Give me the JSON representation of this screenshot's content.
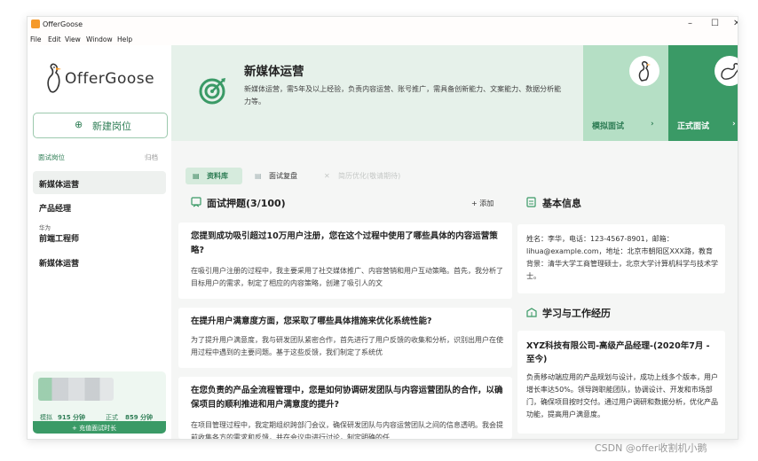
{
  "window": {
    "title": "OfferGoose",
    "controls": {
      "minimize": "–",
      "maximize": "☐",
      "close": "✕"
    }
  },
  "menu": [
    "File",
    "Edit",
    "View",
    "Window",
    "Help"
  ],
  "sidebar": {
    "logo_text": "OfferGoose",
    "new_position_label": "新建岗位",
    "section_label": "面试岗位",
    "archive_label": "归档",
    "items": [
      {
        "title": "新媒体运营",
        "sub": ""
      },
      {
        "title": "产品经理",
        "sub": ""
      },
      {
        "title": "前端工程师",
        "sub": "华为"
      },
      {
        "title": "新媒体运营",
        "sub": ""
      }
    ],
    "stats": {
      "mock_label": "模拟",
      "mock_value": "915 分钟",
      "real_label": "正式",
      "real_value": "859 分钟",
      "recharge_label": "+ 充值面试时长"
    }
  },
  "header": {
    "title": "新媒体运营",
    "description": "新媒体运营，需5年及以上经验，负责内容运营、账号推广，需具备创新能力、文案能力、数据分析能力等。",
    "mock_interview": "模拟面试",
    "real_interview": "正式面试",
    "chevron": "›"
  },
  "tabs": [
    {
      "label": "资料库",
      "state": "active"
    },
    {
      "label": "面试复盘",
      "state": "normal"
    },
    {
      "label": "简历优化(敬请期待)",
      "state": "disabled"
    }
  ],
  "questions": {
    "title": "面试押题(3/100)",
    "add_label": "+ 添加",
    "items": [
      {
        "question": "您提到成功吸引超过10万用户注册，您在这个过程中使用了哪些具体的内容运营策略?",
        "answer": "在吸引用户注册的过程中，我主要采用了社交媒体推广、内容营销和用户互动策略。首先，我分析了目标用户的需求，制定了相应的内容策略，创建了吸引人的文"
      },
      {
        "question": "在提升用户满意度方面，您采取了哪些具体措施来优化系统性能?",
        "answer": "为了提升用户满意度，我与研发团队紧密合作，首先进行了用户反馈的收集和分析，识别出用户在使用过程中遇到的主要问题。基于这些反馈，我们制定了系统优"
      },
      {
        "question": "在您负责的产品全流程管理中，您是如何协调研发团队与内容运营团队的合作，以确保项目的顺利推进和用户满意度的提升?",
        "answer": "在项目管理过程中，我定期组织跨部门会议，确保研发团队与内容运营团队之间的信息透明。我会提前收集各方的需求和反馈，并在会议中进行讨论，制定明确的任"
      }
    ]
  },
  "basic_info": {
    "title": "基本信息",
    "text": "姓名：李华，电话：123-4567-8901，邮箱：lihua@example.com，地址：北京市朝阳区XXX路，教育背景：清华大学工商管理硕士，北京大学计算机科学与技术学士。"
  },
  "experience": {
    "title": "学习与工作经历",
    "entry_title": "XYZ科技有限公司-高级产品经理-(2020年7月 - 至今)",
    "entry_body": "负责移动端应用的产品规划与设计，成功上线多个版本，用户增长率达50%。领导跨职能团队，协调设计、开发和市场部门，确保项目按时交付。通过用户调研和数据分析，优化产品功能，提高用户满意度。"
  },
  "watermark": "CSDN @offer收割机小鹅",
  "colors": {
    "brand_green": "#3a9a66",
    "header_bg": "#e6f1ea",
    "mock_card": "#b5dfc5"
  }
}
